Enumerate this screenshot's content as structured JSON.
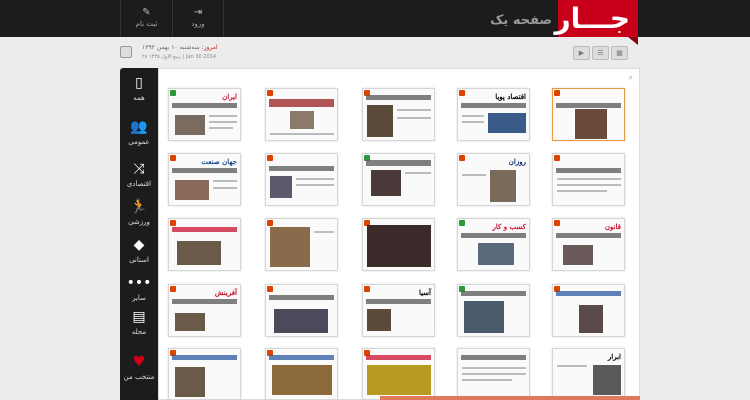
{
  "header": {
    "logo": "جـــار",
    "logo_subtitle": "صفحه یک",
    "login_label": "ورود",
    "register_label": "ثبت نام"
  },
  "date": {
    "label": "امروز:",
    "persian": "سه‌شنبه ۱۰ بهمن ۱۳۹۲",
    "secondary": "۲۸ ربیع الاول ۱۴۳۵ | Jan 30 2014"
  },
  "sidebar": {
    "items": [
      {
        "label": "همه",
        "icon": "newspaper-icon"
      },
      {
        "label": "عمومی",
        "icon": "people-icon"
      },
      {
        "label": "اقتصادی",
        "icon": "chart-icon"
      },
      {
        "label": "ورزشی",
        "icon": "runner-icon"
      },
      {
        "label": "استانی",
        "icon": "iran-map-icon"
      },
      {
        "label": "سایر",
        "icon": "dots-icon"
      },
      {
        "label": "مجله",
        "icon": "magazine-icon"
      },
      {
        "label": "منتخب من",
        "icon": "heart-icon"
      }
    ]
  },
  "papers": {
    "row1": [
      {
        "name": "ایران",
        "color": "#c8102e"
      },
      {
        "name": "",
        "color": "#333333"
      },
      {
        "name": "",
        "color": "#333333"
      },
      {
        "name": "اقتصاد پویا",
        "color": "#1a1a1a"
      },
      {
        "name": "",
        "color": "#333333"
      }
    ],
    "row2": [
      {
        "name": "جهان صنعت",
        "color": "#1a4a8a"
      },
      {
        "name": "",
        "color": "#333333"
      },
      {
        "name": "",
        "color": "#333333"
      },
      {
        "name": "روزان",
        "color": "#0a2a6a"
      },
      {
        "name": "",
        "color": "#333333"
      }
    ],
    "row3": [
      {
        "name": "قانون",
        "color": "#c8102e"
      },
      {
        "name": "کسب و کار",
        "color": "#c8102e"
      },
      {
        "name": "",
        "color": "#333333"
      },
      {
        "name": "",
        "color": "#333333"
      },
      {
        "name": "",
        "color": "#333333"
      }
    ],
    "row4": [
      {
        "name": "",
        "color": "#333333"
      },
      {
        "name": "",
        "color": "#333333"
      },
      {
        "name": "آسیا",
        "color": "#1a1a1a"
      },
      {
        "name": "",
        "color": "#333333"
      },
      {
        "name": "آفرینش",
        "color": "#c8102e"
      }
    ],
    "row5": [
      {
        "name": "ابرار",
        "color": "#1a1a1a"
      },
      {
        "name": "",
        "color": "#333333"
      },
      {
        "name": "",
        "color": "#333333"
      },
      {
        "name": "",
        "color": "#333333"
      },
      {
        "name": "",
        "color": "#333333"
      }
    ]
  }
}
